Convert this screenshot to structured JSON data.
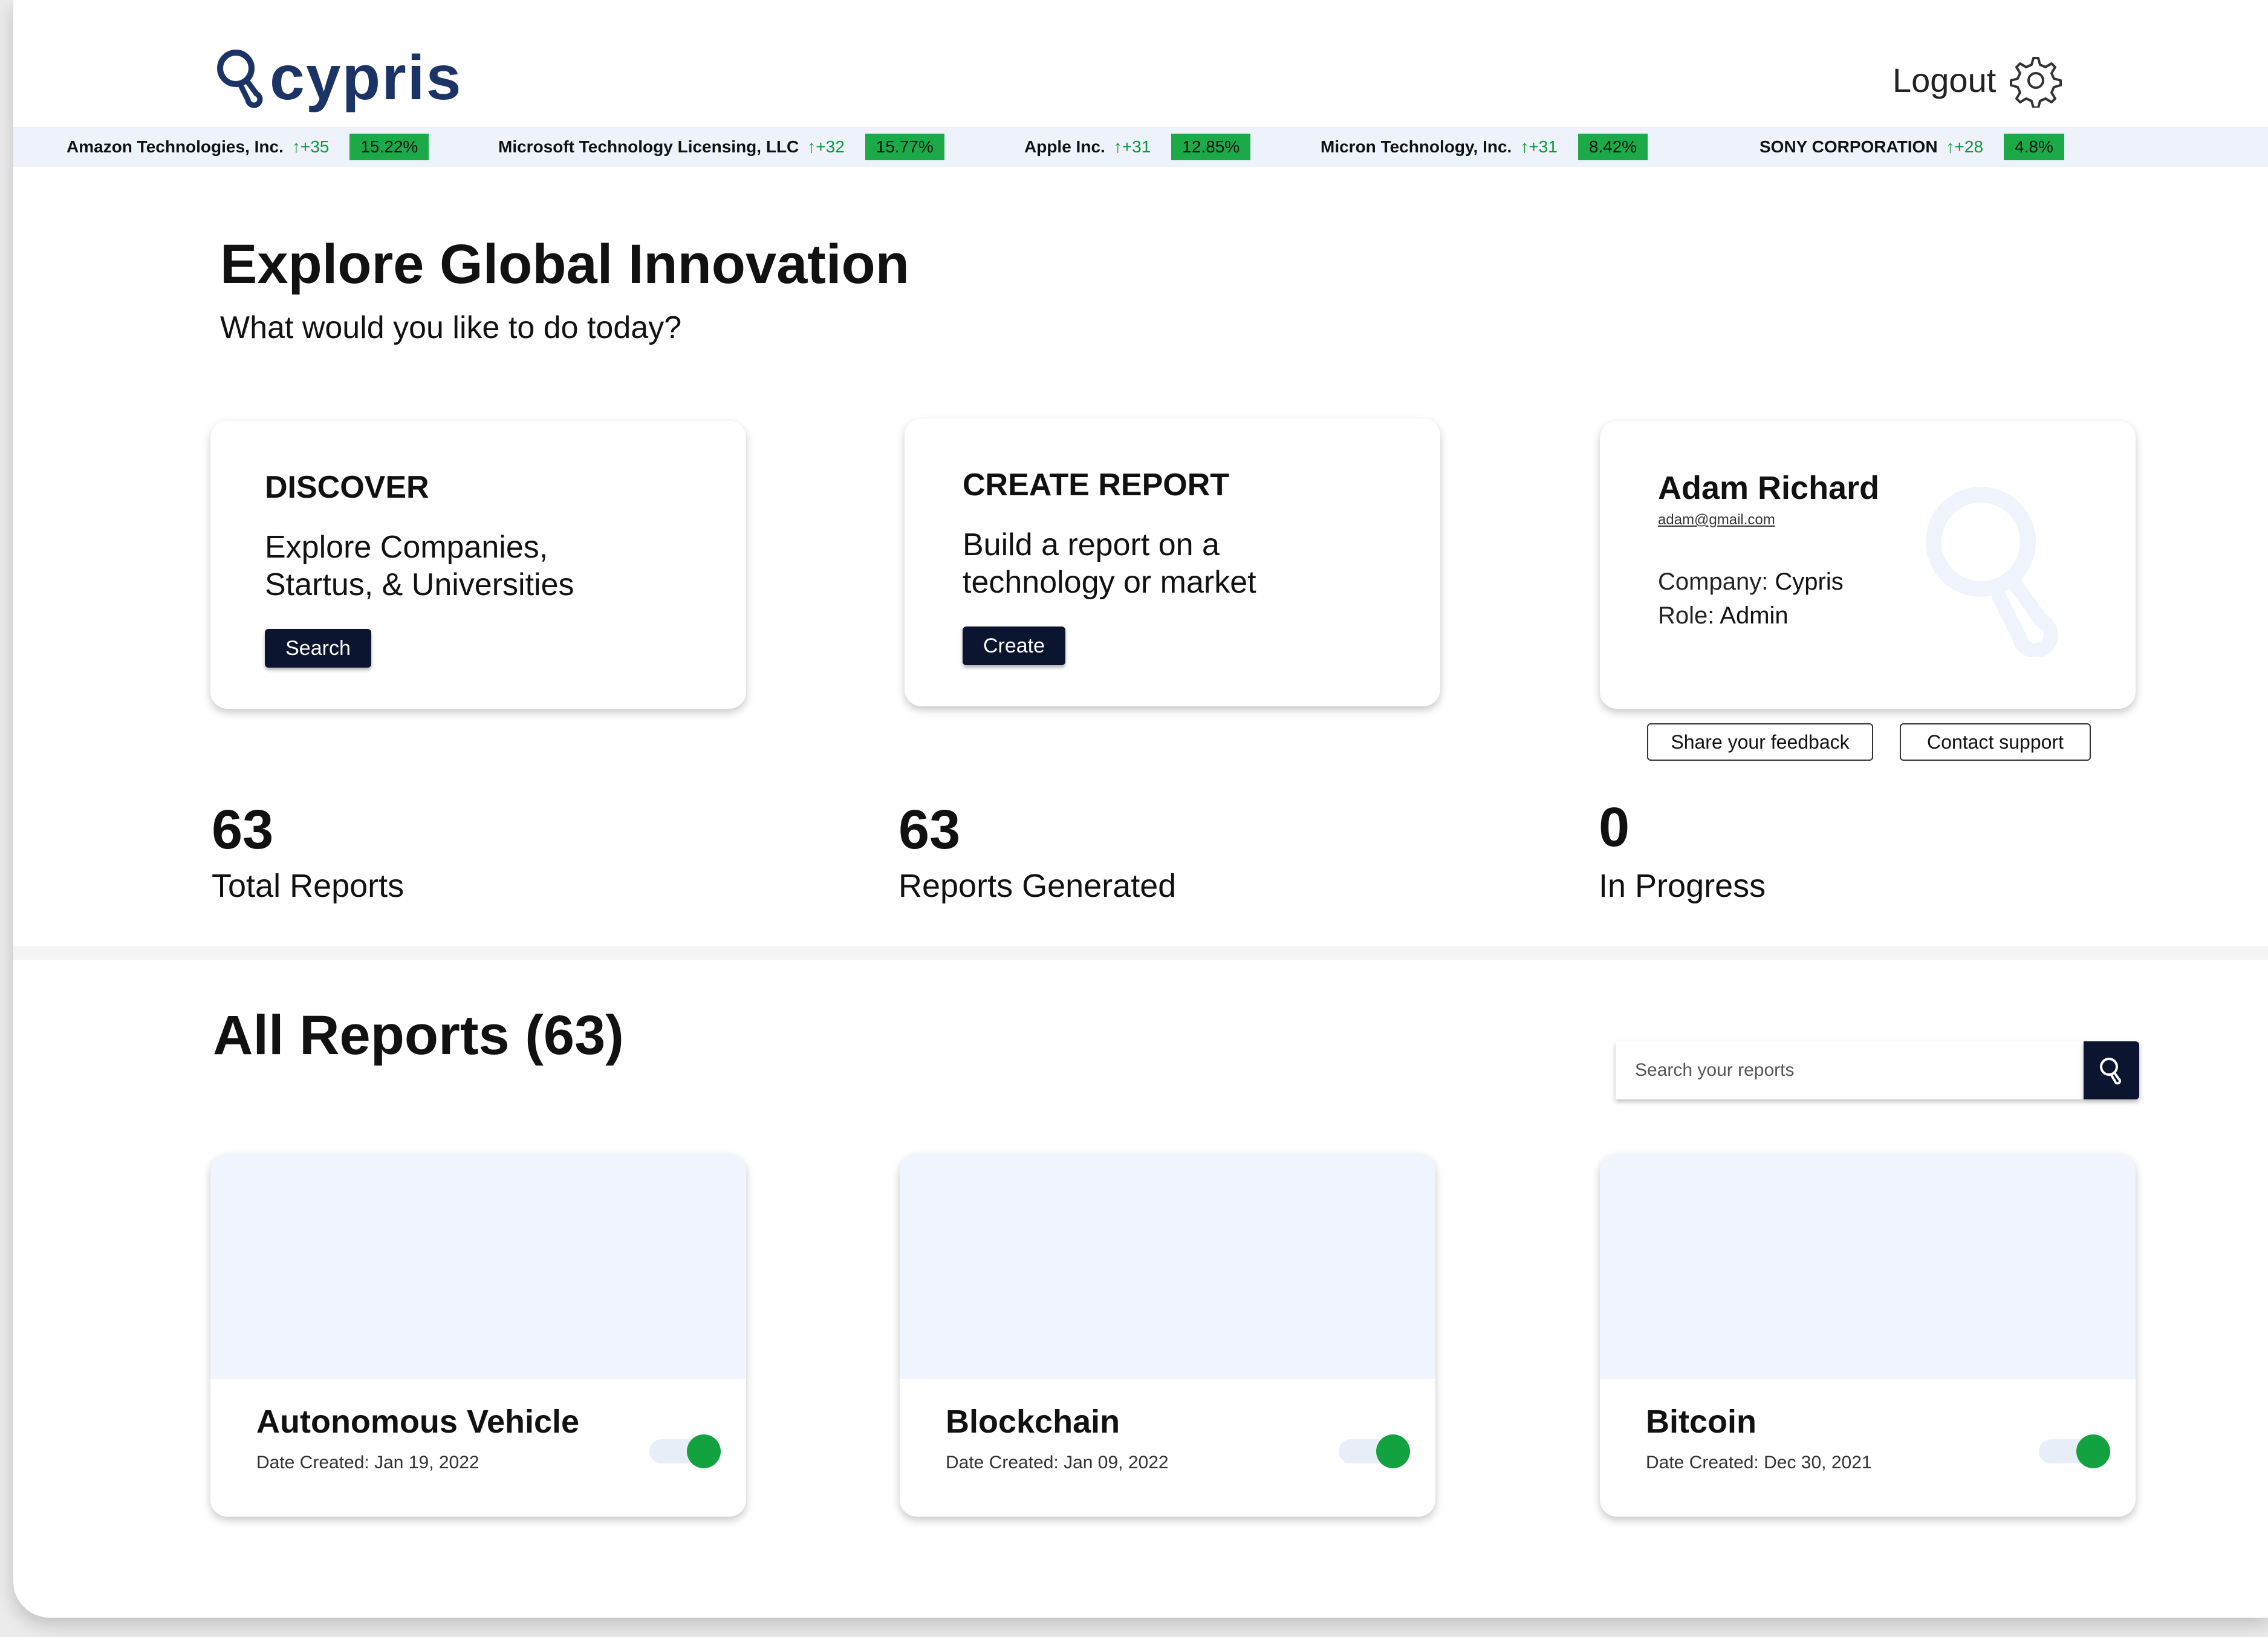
{
  "header": {
    "brand": "cypris",
    "logout_label": "Logout"
  },
  "ticker": [
    {
      "company": "Amazon Technologies, Inc.",
      "change": "+35",
      "percent": "15.22%"
    },
    {
      "company": "Microsoft Technology Licensing, LLC",
      "change": "+32",
      "percent": "15.77%"
    },
    {
      "company": "Apple Inc.",
      "change": "+31",
      "percent": "12.85%"
    },
    {
      "company": "Micron Technology, Inc.",
      "change": "+31",
      "percent": "8.42%"
    },
    {
      "company": "SONY CORPORATION",
      "change": "+28",
      "percent": "4.8%"
    }
  ],
  "hero": {
    "title": "Explore Global Innovation",
    "subtitle": "What would you like to do today?"
  },
  "discover": {
    "heading": "DISCOVER",
    "line1": "Explore Companies,",
    "line2": "Startus, & Universities",
    "button": "Search"
  },
  "create": {
    "heading": "CREATE REPORT",
    "line1": "Build a report on a",
    "line2": "technology or market",
    "button": "Create"
  },
  "user": {
    "name": "Adam Richard",
    "email": "adam@gmail.com",
    "company_label": "Company: ",
    "company": "Cypris",
    "role_label": "Role: ",
    "role": "Admin",
    "feedback_button": "Share your feedback",
    "support_button": "Contact support"
  },
  "stats": [
    {
      "value": "63",
      "label": "Total Reports"
    },
    {
      "value": "63",
      "label": "Reports Generated"
    },
    {
      "value": "0",
      "label": "In Progress"
    }
  ],
  "reports": {
    "title": "All Reports (63)",
    "search_placeholder": "Search your reports",
    "items": [
      {
        "title": "Autonomous Vehicle",
        "date": "Date Created: Jan 19, 2022",
        "enabled": true
      },
      {
        "title": "Blockchain",
        "date": "Date Created: Jan 09, 2022",
        "enabled": true
      },
      {
        "title": "Bitcoin",
        "date": "Date Created: Dec 30, 2021",
        "enabled": true
      }
    ]
  },
  "colors": {
    "brand_navy": "#1c3465",
    "button_dark": "#0b1530",
    "positive_green": "#0a9a3a",
    "percent_badge": "#1caa48",
    "toggle_on": "#12a23f",
    "ticker_bg": "#edf2fb"
  },
  "icons": {
    "logo": "cypris-logo-icon",
    "settings": "gear-icon",
    "trend": "arrow-up-icon",
    "search": "search-icon"
  }
}
